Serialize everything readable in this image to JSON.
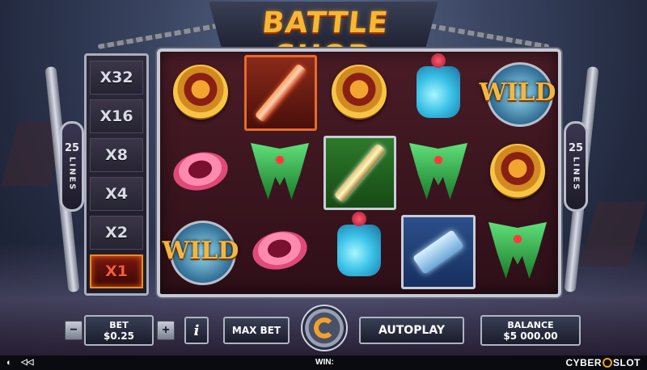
{
  "game": {
    "title": "BATTLE SHOP"
  },
  "multipliers": [
    "X32",
    "X16",
    "X8",
    "X4",
    "X2",
    "X1"
  ],
  "active_multiplier": "X1",
  "lines": {
    "count": "25",
    "label": "LINES"
  },
  "reels": [
    [
      "shield",
      "ring",
      "wild"
    ],
    [
      "fire-staff",
      "helm",
      "ring"
    ],
    [
      "shield",
      "golden-sword",
      "potion"
    ],
    [
      "potion",
      "helm",
      "ice-hammer"
    ],
    [
      "wild",
      "shield",
      "helm"
    ]
  ],
  "wild_label": "WILD",
  "controls": {
    "bet_label": "BET",
    "bet_value": "$0.25",
    "minus": "−",
    "plus": "+",
    "info": "i",
    "max_bet": "MAX BET",
    "autoplay": "AUTOPLAY",
    "balance_label": "BALANCE",
    "balance_value": "$5 000.00"
  },
  "footer": {
    "win_label": "WIN:",
    "brand_left": "CYBER",
    "brand_right": "SLOT"
  },
  "colors": {
    "accent": "#f2a12a",
    "frame": "#c6c9d6",
    "reel_bg": "#3a1520"
  }
}
